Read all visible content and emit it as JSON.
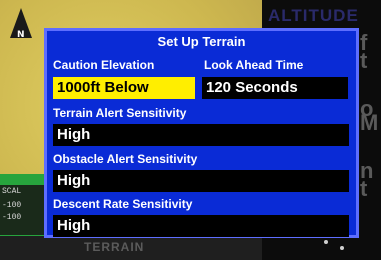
{
  "background": {
    "north_label": "N",
    "scale_lines": [
      "SCAL",
      "-100",
      "-100"
    ],
    "map_tab_label": "TERRAIN",
    "side_title": "ALTITUDE",
    "side_fragments": [
      "f",
      "t",
      "o",
      "M",
      "n",
      "t"
    ]
  },
  "dialog": {
    "title": "Set Up Terrain",
    "caution_elevation": {
      "label": "Caution Elevation",
      "value": "1000ft Below"
    },
    "look_ahead_time": {
      "label": "Look Ahead Time",
      "value": "120 Seconds"
    },
    "terrain_alert_sensitivity": {
      "label": "Terrain Alert Sensitivity",
      "value": "High"
    },
    "obstacle_alert_sensitivity": {
      "label": "Obstacle Alert Sensitivity",
      "value": "High"
    },
    "descent_rate_sensitivity": {
      "label": "Descent Rate Sensitivity",
      "value": "High"
    }
  },
  "colors": {
    "dialog_bg": "#0a2bd6",
    "dialog_border": "#5d6dff",
    "field_bg": "#000000",
    "selected_field_bg": "#ffee00"
  }
}
